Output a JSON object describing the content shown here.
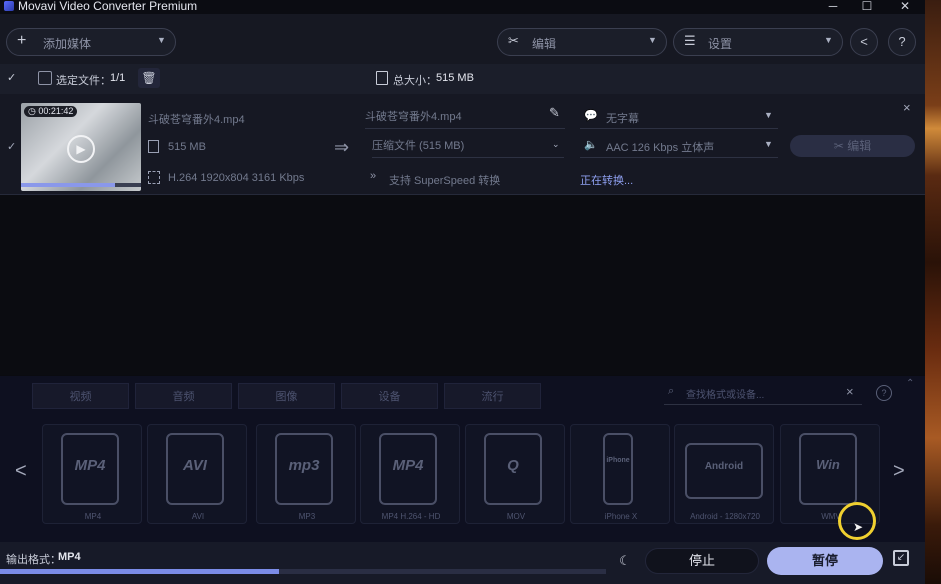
{
  "window": {
    "title": "Movavi Video Converter Premium",
    "minimize_glyph": "─",
    "maximize_glyph": "☐",
    "close_glyph": "✕"
  },
  "toolbar": {
    "add_media_label": "添加媒体",
    "edit_label": "编辑",
    "settings_label": "设置",
    "share_glyph": "<",
    "help_glyph": "?"
  },
  "infobar": {
    "selected_label": "选定文件：",
    "selected_count": "1/1",
    "total_size_label": "总大小：",
    "total_size": "515 MB"
  },
  "file": {
    "duration": "00:21:42",
    "source_name": "斗破苍穹番外4.mp4",
    "source_size": "515 MB",
    "source_info": "H.264 1920x804 3161 Kbps",
    "output_name": "斗破苍穹番外4.mp4",
    "output_size": "压缩文件 (515 MB)",
    "superspeed": "支持 SuperSpeed 转换",
    "subtitle": "无字幕",
    "audio": "AAC 126 Kbps 立体声",
    "status": "正在转换...",
    "edit_label": "编辑",
    "close_glyph": "×",
    "thumb_progress": 0.78
  },
  "formats": {
    "tabs": [
      "视频",
      "音频",
      "图像",
      "设备",
      "流行"
    ],
    "search_placeholder": "查找格式或设备...",
    "clear_glyph": "×",
    "items": [
      {
        "label": "MP4",
        "icon_text": "MP4"
      },
      {
        "label": "AVI",
        "icon_text": "AVI"
      },
      {
        "label": "MP3",
        "icon_text": "mp3"
      },
      {
        "label": "MP4 H.264 - HD",
        "icon_text": "MP4"
      },
      {
        "label": "MOV",
        "icon_text": "Q"
      },
      {
        "label": "iPhone X",
        "icon_text": "iPhone"
      },
      {
        "label": "Android - 1280x720",
        "icon_text": "Android"
      },
      {
        "label": "WMV",
        "icon_text": "Win"
      }
    ],
    "prev_glyph": "<",
    "next_glyph": ">"
  },
  "bottom": {
    "output_format_label": "输出格式：",
    "output_format": "MP4",
    "stop_label": "停止",
    "pause_label": "暂停",
    "progress": 0.46
  },
  "colors": {
    "accent": "#7b8ce8",
    "pause_button": "#aab4f0",
    "cursor_ring": "#f0d030"
  }
}
